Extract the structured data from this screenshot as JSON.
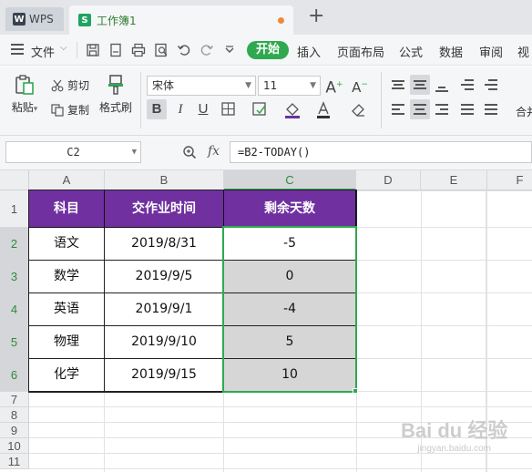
{
  "titlebar": {
    "app_tab": "WPS",
    "doc_tab": "工作簿1",
    "new_tab_symbol": "+",
    "modified_dot_color": "#f0883a"
  },
  "menubar": {
    "file": "文件",
    "start": "开始",
    "items": [
      "插入",
      "页面布局",
      "公式",
      "数据",
      "审阅",
      "视"
    ],
    "accent_color": "#2fa94f",
    "quick_icons": [
      "save-icon",
      "export-pdf-icon",
      "print-icon",
      "print-preview-icon",
      "undo-icon",
      "redo-icon",
      "customize-icon"
    ]
  },
  "ribbon": {
    "paste": "粘贴",
    "cut": "剪切",
    "copy": "复制",
    "format_painter": "格式刷",
    "font_name": "宋体",
    "font_size": "11",
    "merge_partial": "合并"
  },
  "formula_bar": {
    "cell_ref": "C2",
    "fx": "fx",
    "formula": "=B2-TODAY()"
  },
  "sheet": {
    "columns": [
      "A",
      "B",
      "C",
      "D",
      "E",
      "F"
    ],
    "rows": [
      "1",
      "2",
      "3",
      "4",
      "5",
      "6",
      "7",
      "8",
      "9",
      "10",
      "11"
    ],
    "selected_column": "C",
    "selected_rows": [
      "2",
      "3",
      "4",
      "5",
      "6"
    ],
    "header_fill": "#7030a0",
    "table": {
      "headers": [
        "科目",
        "交作业时间",
        "剩余天数"
      ],
      "rows": [
        [
          "语文",
          "2019/8/31",
          "-5"
        ],
        [
          "数学",
          "2019/9/5",
          "0"
        ],
        [
          "英语",
          "2019/9/1",
          "-4"
        ],
        [
          "物理",
          "2019/9/10",
          "5"
        ],
        [
          "化学",
          "2019/9/15",
          "10"
        ]
      ]
    }
  },
  "watermark": {
    "main": "Bai du 经验",
    "sub": "jingyan.baidu.com"
  }
}
